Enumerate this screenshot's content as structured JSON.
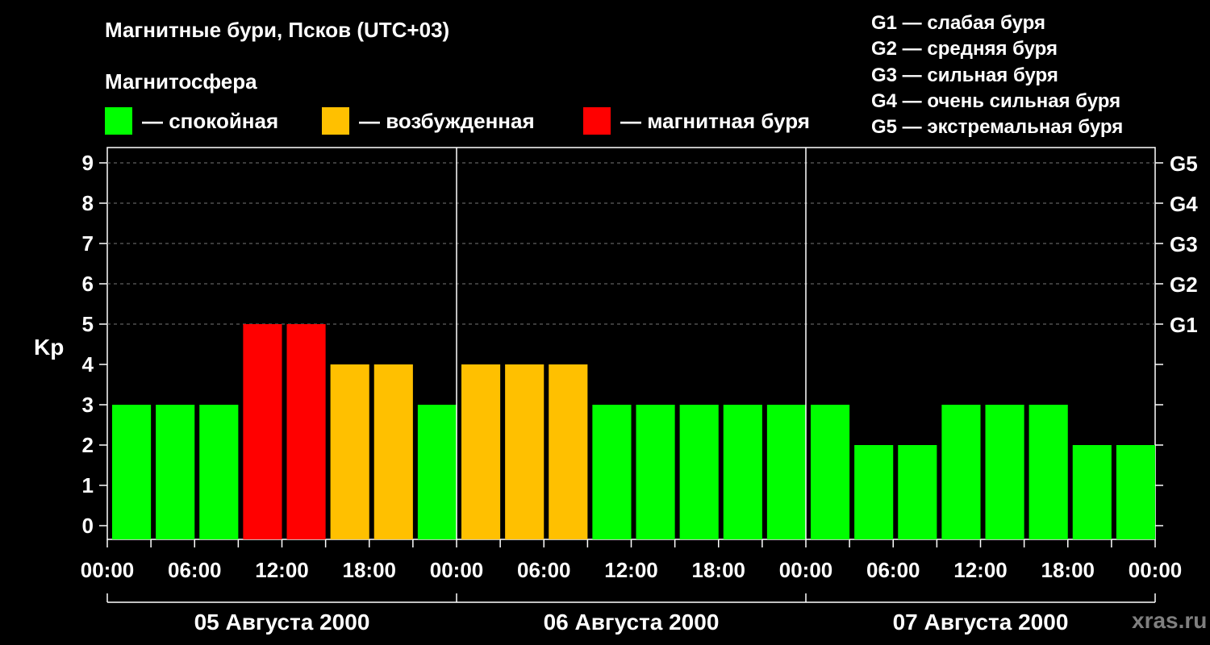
{
  "header": {
    "title": "Магнитные бури, Псков (UTC+03)",
    "subtitle": "Магнитосфера"
  },
  "legend": [
    {
      "label": "— спокойная",
      "color": "#00ff00"
    },
    {
      "label": "— возбужденная",
      "color": "#ffc000"
    },
    {
      "label": "— магнитная буря",
      "color": "#ff0000"
    }
  ],
  "g_scale_legend": [
    "G1 — слабая буря",
    "G2 — средняя буря",
    "G3 — сильная буря",
    "G4 — очень сильная буря",
    "G5 — экстремальная буря"
  ],
  "credit": "xras.ru",
  "chart_data": {
    "type": "bar",
    "title": "Магнитные бури, Псков (UTC+03)",
    "ylabel": "Kp",
    "ylim": [
      0,
      9
    ],
    "y_ticks": [
      "0",
      "1",
      "2",
      "3",
      "4",
      "5",
      "6",
      "7",
      "8",
      "9"
    ],
    "right_axis_ticks": [
      {
        "y": 5,
        "label": "G1"
      },
      {
        "y": 6,
        "label": "G2"
      },
      {
        "y": 7,
        "label": "G3"
      },
      {
        "y": 8,
        "label": "G4"
      },
      {
        "y": 9,
        "label": "G5"
      }
    ],
    "x_tick_labels": [
      "00:00",
      "06:00",
      "12:00",
      "18:00",
      "00:00",
      "06:00",
      "12:00",
      "18:00",
      "00:00",
      "06:00",
      "12:00",
      "18:00",
      "00:00"
    ],
    "days": [
      "05 Августа 2000",
      "06 Августа 2000",
      "07 Августа 2000"
    ],
    "interval_hours": 3,
    "values": [
      3,
      3,
      3,
      5,
      5,
      4,
      4,
      3,
      4,
      4,
      4,
      3,
      3,
      3,
      3,
      3,
      3,
      2,
      2,
      3,
      3,
      3,
      2,
      2
    ],
    "color_thresholds": {
      "quiet": "< 4",
      "active": "4",
      "storm": ">= 5"
    },
    "colors": {
      "quiet": "#00ff00",
      "active": "#ffc000",
      "storm": "#ff0000"
    },
    "grid": "dashed horizontal at Kp 5–9"
  }
}
